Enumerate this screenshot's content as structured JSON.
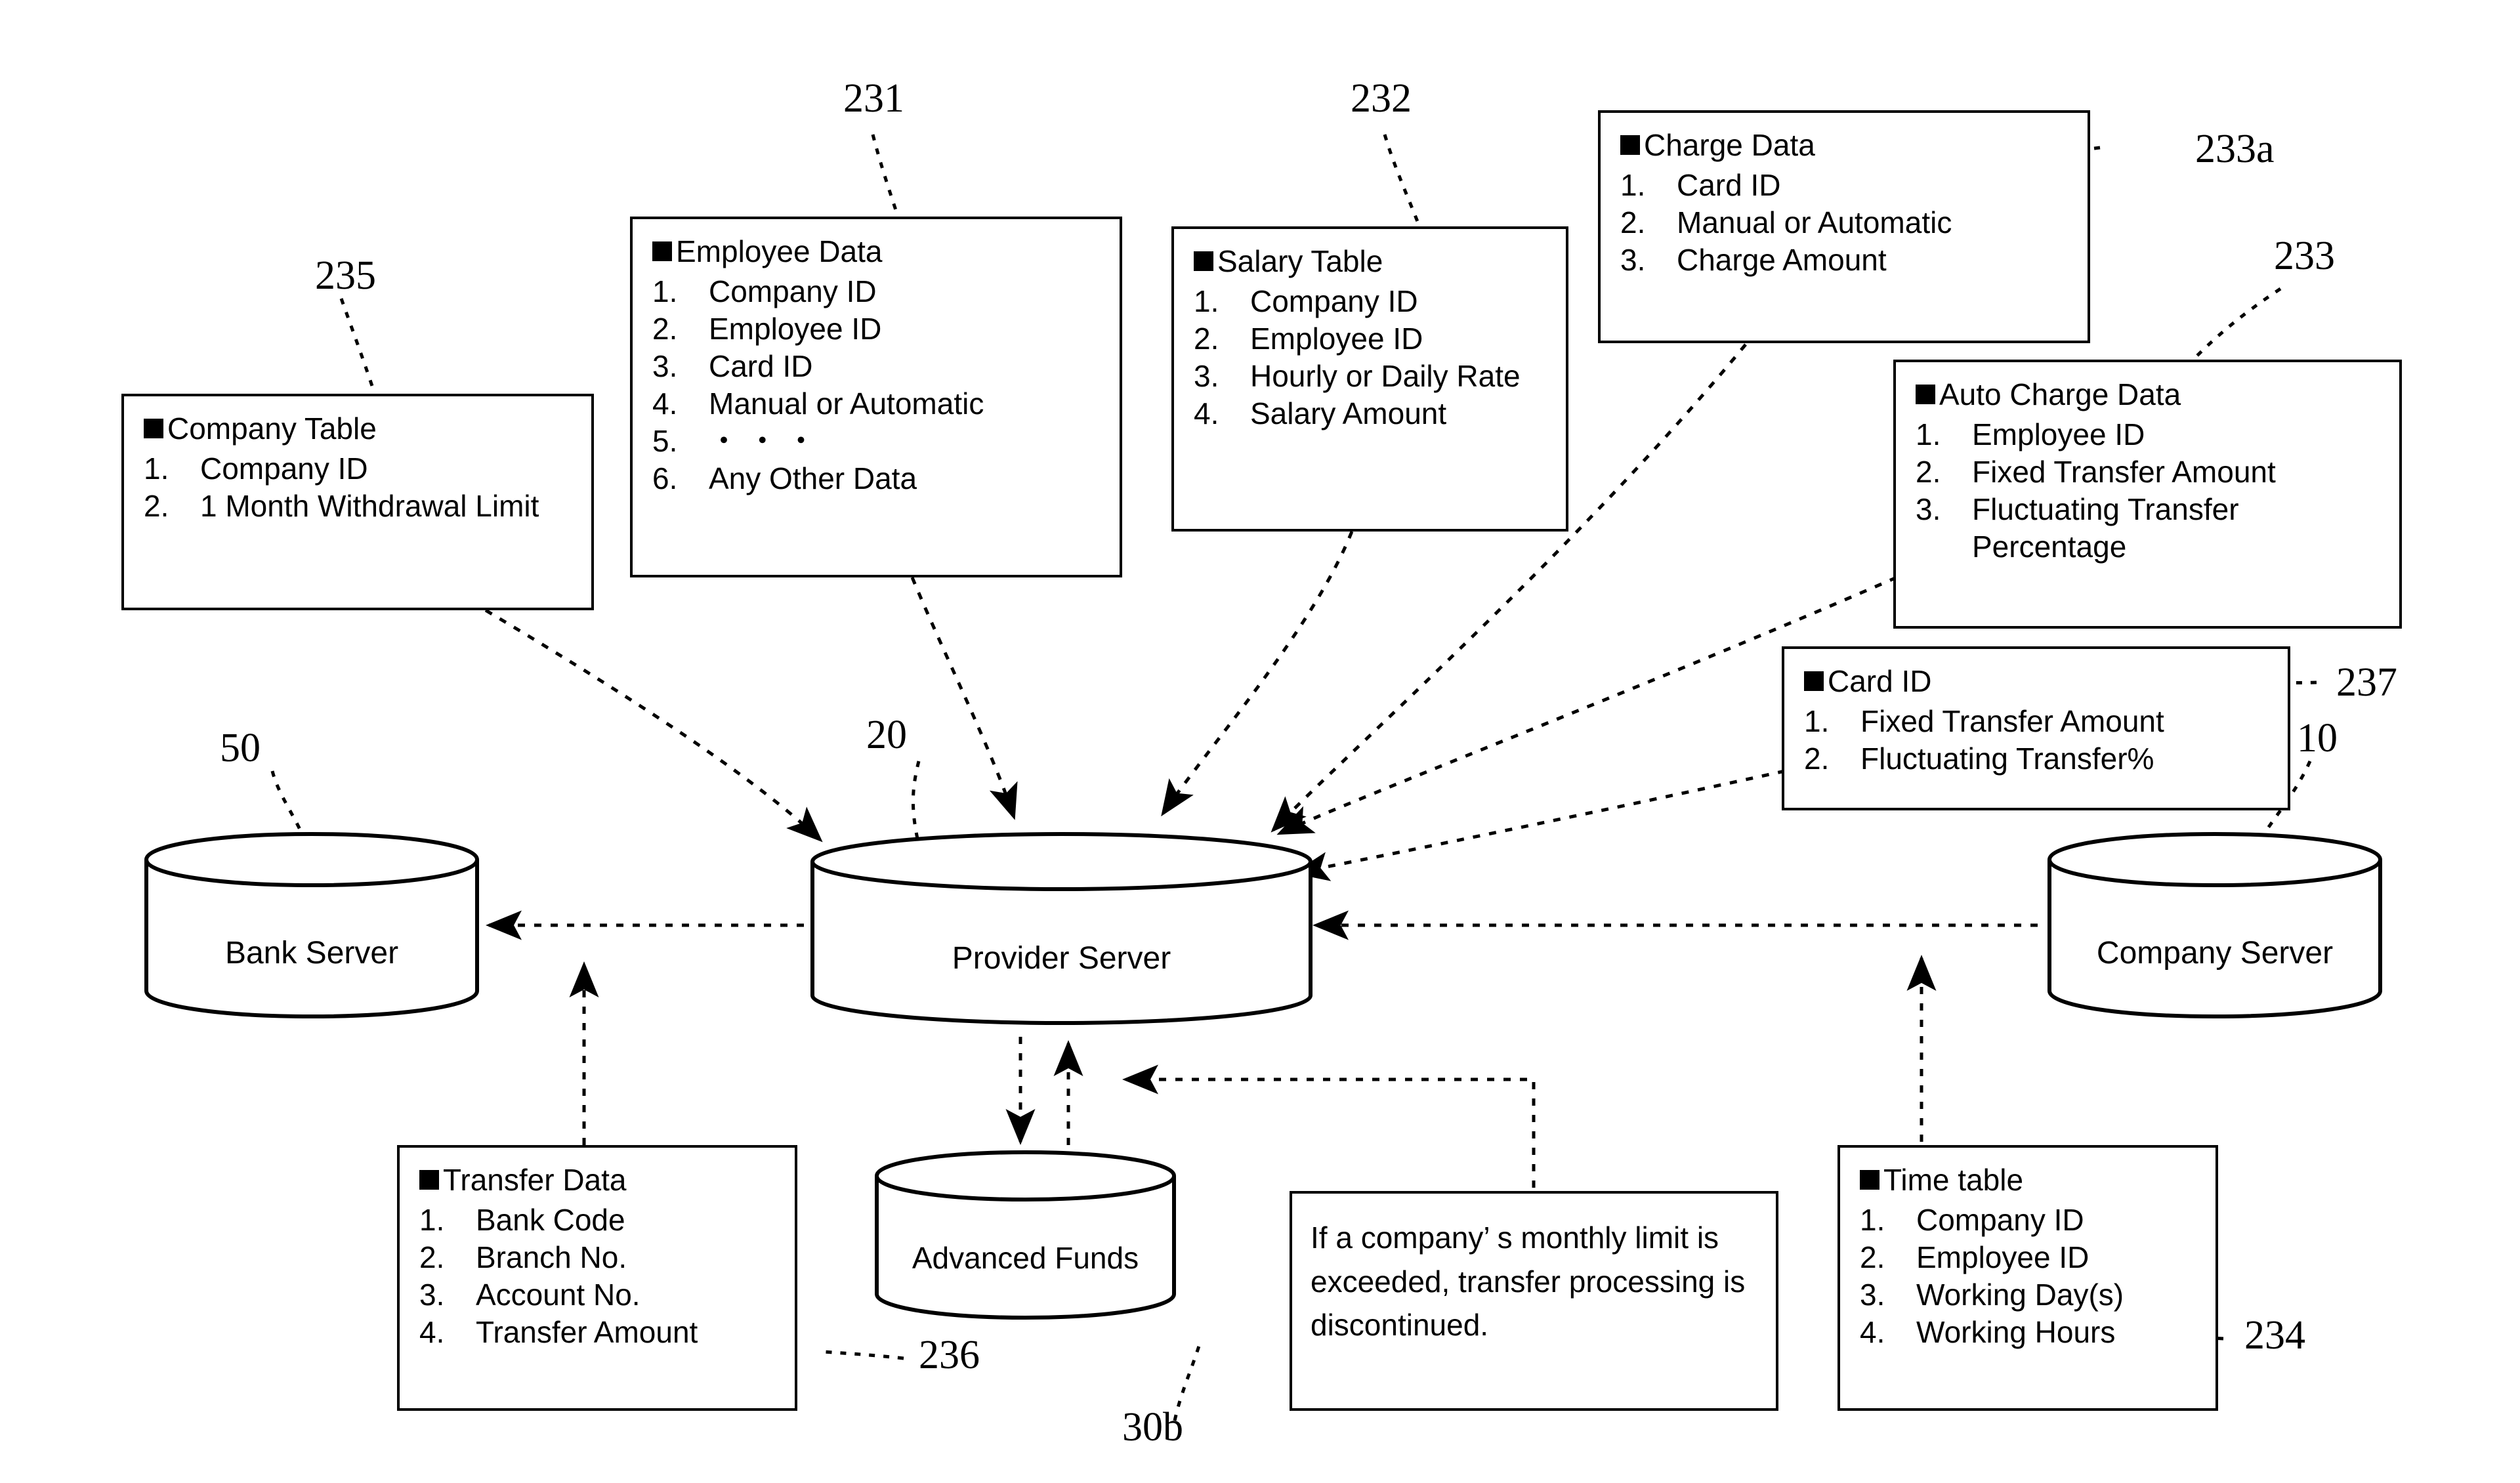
{
  "figure": {
    "kind": "patent-system-diagram"
  },
  "boxes": {
    "company_table": {
      "title": "Company Table",
      "items": [
        {
          "n": "1.",
          "t": "Company ID"
        },
        {
          "n": "2.",
          "t": "1 Month Withdrawal Limit"
        }
      ],
      "ref": "235"
    },
    "employee_data": {
      "title": "Employee Data",
      "items": [
        {
          "n": "1.",
          "t": "Company ID"
        },
        {
          "n": "2.",
          "t": "Employee ID"
        },
        {
          "n": "3.",
          "t": "Card ID"
        },
        {
          "n": "4.",
          "t": "Manual or Automatic"
        },
        {
          "n": "5.",
          "t": "・ ・ ・"
        },
        {
          "n": "6.",
          "t": "Any Other Data"
        }
      ],
      "ref": "231"
    },
    "salary_table": {
      "title": "Salary Table",
      "items": [
        {
          "n": "1.",
          "t": "Company ID"
        },
        {
          "n": "2.",
          "t": "Employee ID"
        },
        {
          "n": "3.",
          "t": "Hourly or Daily Rate"
        },
        {
          "n": "4.",
          "t": "Salary Amount"
        }
      ],
      "ref": "232"
    },
    "charge_data": {
      "title": "Charge Data",
      "items": [
        {
          "n": "1.",
          "t": "Card ID"
        },
        {
          "n": "2.",
          "t": "Manual or Automatic"
        },
        {
          "n": "3.",
          "t": "Charge Amount"
        }
      ],
      "ref": "233a"
    },
    "auto_charge_data": {
      "title": "Auto Charge Data",
      "items": [
        {
          "n": "1.",
          "t": "Employee ID"
        },
        {
          "n": "2.",
          "t": "Fixed Transfer Amount"
        },
        {
          "n": "3.",
          "t": "Fluctuating Transfer Percentage"
        }
      ],
      "ref": "233"
    },
    "card_id": {
      "title": "Card ID",
      "items": [
        {
          "n": "1.",
          "t": "Fixed Transfer Amount"
        },
        {
          "n": "2.",
          "t": "Fluctuating  Transfer%"
        }
      ],
      "ref": "237"
    },
    "transfer_data": {
      "title": "Transfer Data",
      "items": [
        {
          "n": "1.",
          "t": "Bank Code"
        },
        {
          "n": "2.",
          "t": "Branch No."
        },
        {
          "n": "3.",
          "t": "Account No."
        },
        {
          "n": "4.",
          "t": "Transfer Amount"
        }
      ],
      "ref": "236"
    },
    "time_table": {
      "title": "Time table",
      "items": [
        {
          "n": "1.",
          "t": "Company ID"
        },
        {
          "n": "2.",
          "t": "Employee ID"
        },
        {
          "n": "3.",
          "t": "Working Day(s)"
        },
        {
          "n": "4.",
          "t": "Working Hours"
        }
      ],
      "ref": "234"
    }
  },
  "note": {
    "text": "If a company’ s monthly limit is exceeded, transfer processing is discontinued."
  },
  "nodes": {
    "bank_server": {
      "label": "Bank Server",
      "ref": "50"
    },
    "provider_server": {
      "label": "Provider Server",
      "ref": "20"
    },
    "company_server": {
      "label": "Company Server",
      "ref": "10"
    },
    "advanced_funds": {
      "label": "Advanced Funds",
      "ref": "30b"
    }
  },
  "colors": {
    "ink": "#000000",
    "paper": "#ffffff"
  }
}
